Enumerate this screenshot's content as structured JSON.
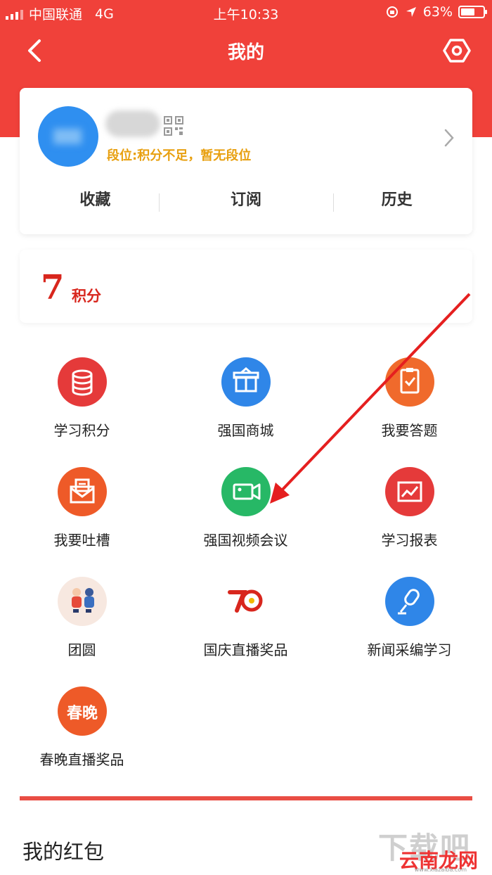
{
  "status_bar": {
    "carrier": "中国联通",
    "network": "4G",
    "time": "上午10:33",
    "battery": "63%",
    "battery_level": 0.63
  },
  "header": {
    "title": "我的",
    "back_icon": "back-arrow-icon",
    "settings_icon": "settings-hex-icon"
  },
  "profile": {
    "rank_text": "段位:积分不足，暂无段位",
    "tabs": [
      "收藏",
      "订阅",
      "历史"
    ]
  },
  "points": {
    "value": "7",
    "label": "积分"
  },
  "features": [
    {
      "label": "学习积分",
      "icon": "coins-icon",
      "color": "#e53a3a"
    },
    {
      "label": "强国商城",
      "icon": "gift-box-icon",
      "color": "#2f86e8"
    },
    {
      "label": "我要答题",
      "icon": "clipboard-icon",
      "color": "#f06a2c"
    },
    {
      "label": "我要吐槽",
      "icon": "mail-icon",
      "color": "#ee5a28"
    },
    {
      "label": "强国视频会议",
      "icon": "video-camera-icon",
      "color": "#27b866"
    },
    {
      "label": "学习报表",
      "icon": "chart-icon",
      "color": "#e53a3a"
    },
    {
      "label": "团圆",
      "icon": "family-icon",
      "color": "#f7e8e0"
    },
    {
      "label": "国庆直播奖品",
      "icon": "seventy-anniversary-icon",
      "color": "#ffffff"
    },
    {
      "label": "新闻采编学习",
      "icon": "microphone-icon",
      "color": "#2f86e8"
    },
    {
      "label": "春晚直播奖品",
      "icon": "spring-gala-icon",
      "color": "#ee5a28",
      "icon_text": "春晚"
    }
  ],
  "red_packet": {
    "title": "我的红包"
  },
  "watermark": {
    "big": "下载吧",
    "red": "云南龙网",
    "url": "www.xiazaiba.com"
  },
  "colors": {
    "header_red": "#f0413a",
    "points_red": "#d8261d",
    "rank_gold": "#e8a010"
  }
}
